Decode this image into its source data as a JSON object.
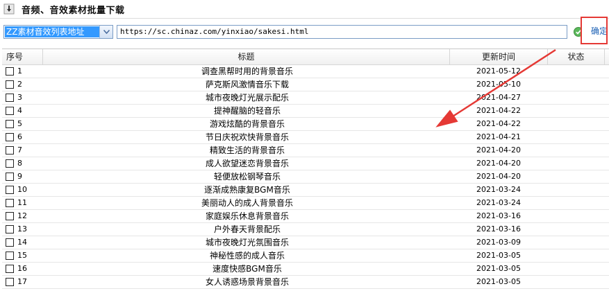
{
  "window": {
    "title": "音频、音效素材批量下载"
  },
  "toolbar": {
    "source_selected": "ZZ素材音效列表地址",
    "url_value": "https://sc.chinaz.com/yinxiao/sakesi.html",
    "confirm_label": "确定",
    "annotation_color": "#e53935"
  },
  "table": {
    "columns": [
      "序号",
      "标题",
      "更新时间",
      "状态"
    ],
    "rows": [
      {
        "num": "1",
        "title": "调查黑帮时用的背景音乐",
        "date": "2021-05-12",
        "status": ""
      },
      {
        "num": "2",
        "title": "萨克斯风激情音乐下载",
        "date": "2021-05-10",
        "status": ""
      },
      {
        "num": "3",
        "title": "城市夜晚灯光展示配乐",
        "date": "2021-04-27",
        "status": ""
      },
      {
        "num": "4",
        "title": "提神醒脑的轻音乐",
        "date": "2021-04-22",
        "status": ""
      },
      {
        "num": "5",
        "title": "游戏炫酷的背景音乐",
        "date": "2021-04-22",
        "status": ""
      },
      {
        "num": "6",
        "title": "节日庆祝欢快背景音乐",
        "date": "2021-04-21",
        "status": ""
      },
      {
        "num": "7",
        "title": "精致生活的背景音乐",
        "date": "2021-04-20",
        "status": ""
      },
      {
        "num": "8",
        "title": "成人欲望迷恋背景音乐",
        "date": "2021-04-20",
        "status": ""
      },
      {
        "num": "9",
        "title": "轻便放松钢琴音乐",
        "date": "2021-04-20",
        "status": ""
      },
      {
        "num": "10",
        "title": "逐渐成熟康复BGM音乐",
        "date": "2021-03-24",
        "status": ""
      },
      {
        "num": "11",
        "title": "美丽动人的成人背景音乐",
        "date": "2021-03-24",
        "status": ""
      },
      {
        "num": "12",
        "title": "家庭娱乐休息背景音乐",
        "date": "2021-03-16",
        "status": ""
      },
      {
        "num": "13",
        "title": "户外春天背景配乐",
        "date": "2021-03-16",
        "status": ""
      },
      {
        "num": "14",
        "title": "城市夜晚灯光氛围音乐",
        "date": "2021-03-09",
        "status": ""
      },
      {
        "num": "15",
        "title": "神秘性感的成人音乐",
        "date": "2021-03-05",
        "status": ""
      },
      {
        "num": "16",
        "title": "速度快感BGM音乐",
        "date": "2021-03-05",
        "status": ""
      },
      {
        "num": "17",
        "title": "女人诱惑场景背景音乐",
        "date": "2021-03-05",
        "status": ""
      }
    ]
  }
}
